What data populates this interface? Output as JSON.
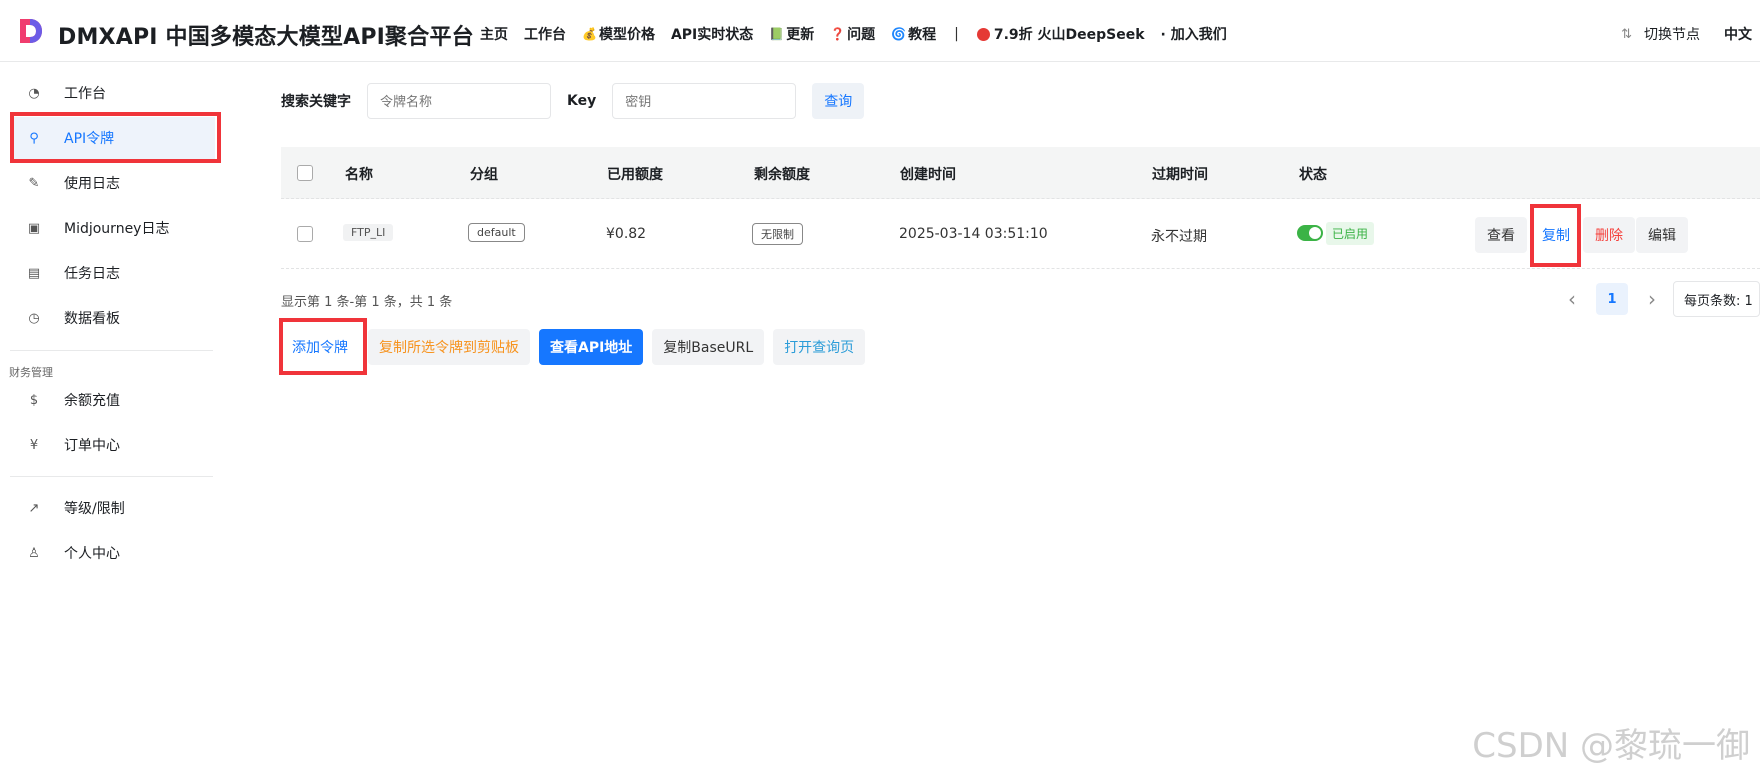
{
  "header": {
    "brand": "DMXAPI 中国多模态大模型API聚合平台",
    "nav": [
      {
        "label": "主页",
        "icon": ""
      },
      {
        "label": "工作台",
        "icon": ""
      },
      {
        "label": "模型价格",
        "icon": "💰"
      },
      {
        "label": "API实时状态",
        "icon": ""
      },
      {
        "label": "更新",
        "icon": "📗"
      },
      {
        "label": "问题",
        "icon": "❓"
      },
      {
        "label": "教程",
        "icon": "🌀"
      }
    ],
    "separator": "|",
    "promo": "7.9折 火山DeepSeek",
    "join": "· 加入我们",
    "switch_node": "切换节点",
    "language": "中文",
    "logo_colors": {
      "left": "#f03d6e",
      "right": "#6c5ce7"
    }
  },
  "sidebar": {
    "items": [
      {
        "label": "工作台",
        "icon": "dashboard-icon"
      },
      {
        "label": "API令牌",
        "icon": "search-key-icon"
      },
      {
        "label": "使用日志",
        "icon": "log-icon"
      },
      {
        "label": "Midjourney日志",
        "icon": "image-icon"
      },
      {
        "label": "任务日志",
        "icon": "film-icon"
      },
      {
        "label": "数据看板",
        "icon": "clock-icon"
      }
    ],
    "finance_group": "财务管理",
    "finance_items": [
      {
        "label": "余额充值",
        "icon": "coin-icon"
      },
      {
        "label": "订单中心",
        "icon": "order-icon"
      }
    ],
    "bottom_items": [
      {
        "label": "等级/限制",
        "icon": "trend-icon"
      },
      {
        "label": "个人中心",
        "icon": "user-icon"
      }
    ]
  },
  "search": {
    "keyword_label": "搜索关键字",
    "keyword_placeholder": "令牌名称",
    "key_label": "Key",
    "key_placeholder": "密钥",
    "query_button": "查询"
  },
  "table": {
    "headers": [
      "名称",
      "分组",
      "已用额度",
      "剩余额度",
      "创建时间",
      "过期时间",
      "状态"
    ],
    "rows": [
      {
        "name": "FTP_LI",
        "group": "default",
        "used": "¥0.82",
        "remaining": "无限制",
        "created": "2025-03-14 03:51:10",
        "expires": "永不过期",
        "status": "已启用",
        "actions": {
          "view": "查看",
          "copy": "复制",
          "delete": "删除",
          "edit": "编辑"
        }
      }
    ]
  },
  "pagination": {
    "summary": "显示第 1 条-第 1 条，共 1 条",
    "current_page": "1",
    "page_size_label": "每页条数: 1"
  },
  "buttons": {
    "add_token": "添加令牌",
    "copy_selected": "复制所选令牌到剪贴板",
    "view_api": "查看API地址",
    "copy_base_url": "复制BaseURL",
    "open_query": "打开查询页"
  },
  "watermark": "CSDN @黎琉一御",
  "colors": {
    "accent": "#1677ff",
    "highlight": "#f0343a",
    "success": "#3bb346",
    "warning": "#f7931e",
    "danger": "#f5413c"
  }
}
